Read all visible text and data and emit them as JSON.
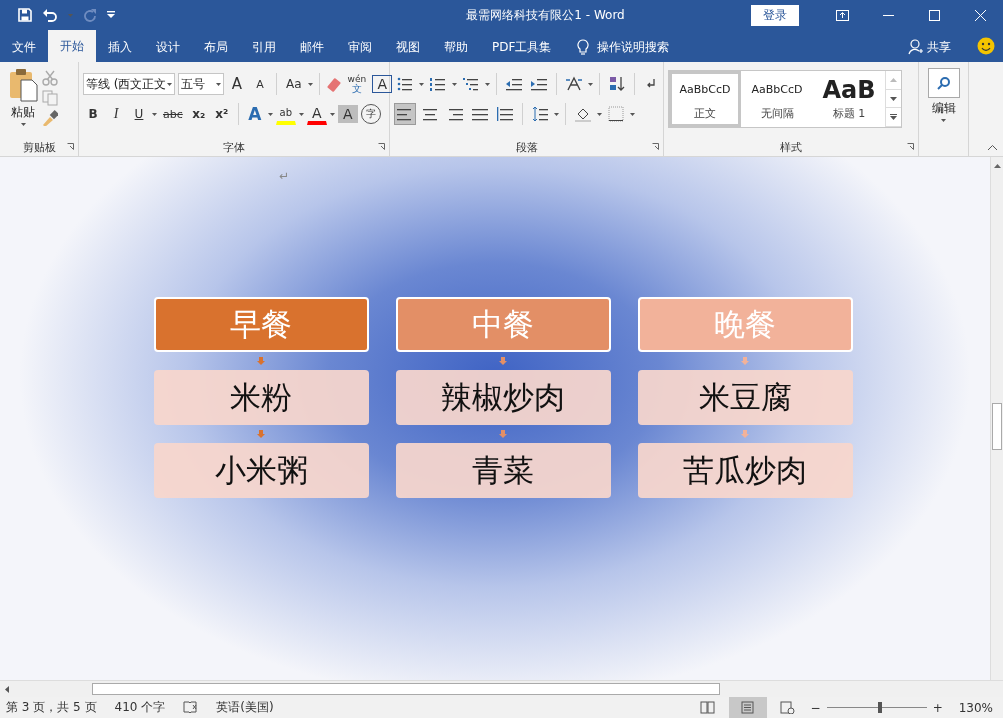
{
  "window": {
    "title": "最需网络科技有限公1  -  Word",
    "sign_in": "登录"
  },
  "tabs": [
    {
      "label": "文件",
      "selected": false
    },
    {
      "label": "开始",
      "selected": true
    },
    {
      "label": "插入",
      "selected": false
    },
    {
      "label": "设计",
      "selected": false
    },
    {
      "label": "布局",
      "selected": false
    },
    {
      "label": "引用",
      "selected": false
    },
    {
      "label": "邮件",
      "selected": false
    },
    {
      "label": "审阅",
      "selected": false
    },
    {
      "label": "视图",
      "selected": false
    },
    {
      "label": "帮助",
      "selected": false
    },
    {
      "label": "PDF工具集",
      "selected": false
    }
  ],
  "tell_me": "操作说明搜索",
  "share": "共享",
  "ribbon": {
    "clipboard": {
      "paste": "粘贴",
      "label": "剪贴板"
    },
    "font": {
      "font_name": "等线 (西文正文",
      "font_size": "五号",
      "grow": "A",
      "shrink": "A",
      "change_case": "Aa",
      "phonetic_top": "wén",
      "phonetic_bottom": "文",
      "char_border": "A",
      "format": [
        "B",
        "I",
        "U",
        "abc",
        "x₂",
        "x²"
      ],
      "text_effect": "A",
      "highlight": "ab",
      "font_color": "A",
      "shading": "A",
      "enclose": "字",
      "label": "字体"
    },
    "paragraph": {
      "label": "段落"
    },
    "styles": {
      "items": [
        {
          "preview": "AaBbCcD",
          "name": "正文",
          "selected": true
        },
        {
          "preview": "AaBbCcD",
          "name": "无间隔",
          "selected": false
        },
        {
          "preview": "AaB",
          "name": "标题 1",
          "selected": false
        }
      ],
      "label": "样式"
    },
    "editing": {
      "label": "编辑"
    }
  },
  "document": {
    "paragraph_mark": "↵",
    "columns": [
      {
        "title": "早餐",
        "color": "#d9722e",
        "items": [
          "米粉",
          "小米粥"
        ]
      },
      {
        "title": "中餐",
        "color": "#e38f66",
        "items": [
          "辣椒炒肉",
          "青菜"
        ]
      },
      {
        "title": "晚餐",
        "color": "#f2b29a",
        "items": [
          "米豆腐",
          "苦瓜炒肉"
        ]
      }
    ]
  },
  "status_bar": {
    "page_info": "第 3 页，共 5 页",
    "word_count": "410 个字",
    "language": "英语(美国)",
    "views": [
      {
        "selected": false
      },
      {
        "selected": true
      },
      {
        "selected": false
      }
    ],
    "zoom": {
      "minus": "−",
      "plus": "+",
      "level": 0.53,
      "percent": "130%"
    }
  }
}
